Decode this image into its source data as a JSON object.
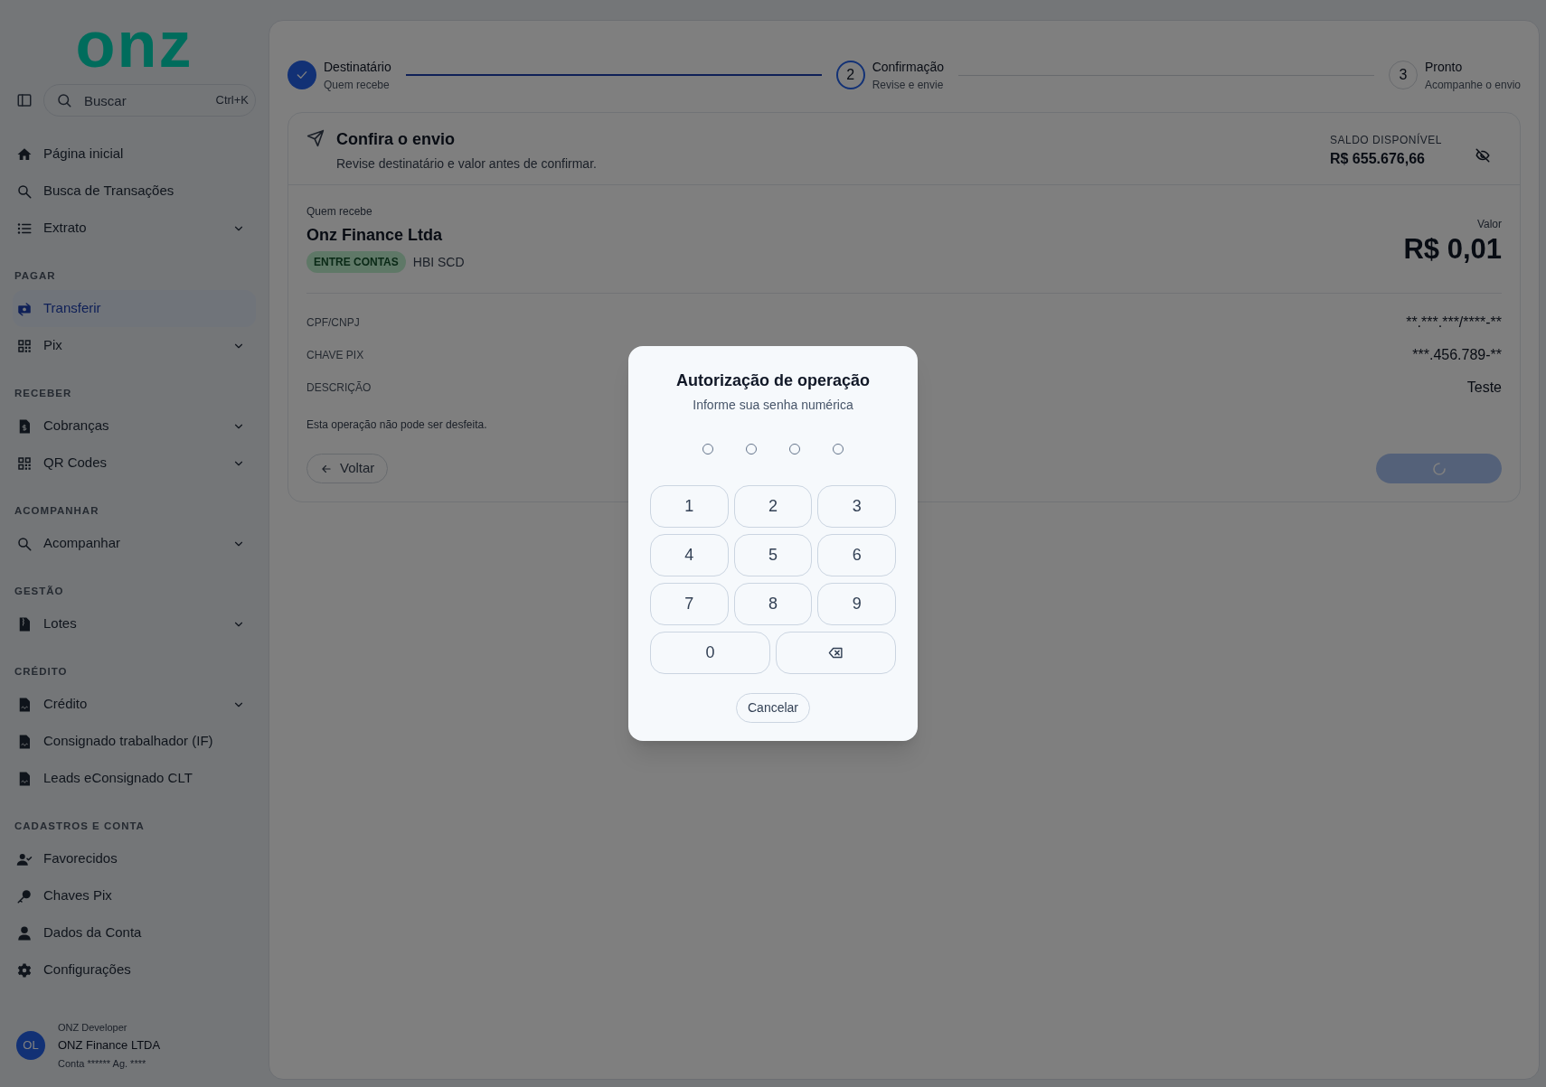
{
  "sidebar": {
    "logo": "onz",
    "search": {
      "placeholder": "Buscar",
      "shortcut": "Ctrl+K"
    },
    "sections": [
      {
        "items": [
          {
            "label": "Página inicial",
            "expandable": false,
            "selected": false
          },
          {
            "label": "Busca de Transações",
            "expandable": false,
            "selected": false
          },
          {
            "label": "Extrato",
            "expandable": true,
            "selected": false
          }
        ]
      },
      {
        "heading": "PAGAR",
        "items": [
          {
            "label": "Transferir",
            "expandable": false,
            "selected": true
          },
          {
            "label": "Pix",
            "expandable": true,
            "selected": false
          }
        ]
      },
      {
        "heading": "RECEBER",
        "items": [
          {
            "label": "Cobranças",
            "expandable": true,
            "selected": false
          },
          {
            "label": "QR Codes",
            "expandable": true,
            "selected": false
          }
        ]
      },
      {
        "heading": "ACOMPANHAR",
        "items": [
          {
            "label": "Acompanhar",
            "expandable": true,
            "selected": false
          }
        ]
      },
      {
        "heading": "GESTÃO",
        "items": [
          {
            "label": "Lotes",
            "expandable": true,
            "selected": false
          }
        ]
      },
      {
        "heading": "CRÉDITO",
        "items": [
          {
            "label": "Crédito",
            "expandable": true,
            "selected": false
          },
          {
            "label": "Consignado trabalhador (IF)",
            "expandable": false,
            "selected": false
          },
          {
            "label": "Leads eConsignado CLT",
            "expandable": false,
            "selected": false
          }
        ]
      },
      {
        "heading": "CADASTROS E CONTA",
        "items": [
          {
            "label": "Favorecidos",
            "expandable": false,
            "selected": false
          },
          {
            "label": "Chaves Pix",
            "expandable": false,
            "selected": false
          },
          {
            "label": "Dados da Conta",
            "expandable": false,
            "selected": false
          },
          {
            "label": "Configurações",
            "expandable": false,
            "selected": false
          }
        ]
      }
    ],
    "user": {
      "initials": "OL",
      "role": "ONZ Developer",
      "company": "ONZ Finance LTDA",
      "account": "Conta ****** Ag. ****"
    }
  },
  "stepper": [
    {
      "title": "Destinatário",
      "subtitle": "Quem recebe",
      "completed": true,
      "selected": false
    },
    {
      "number": "2",
      "title": "Confirmação",
      "subtitle": "Revise e envie",
      "completed": false,
      "selected": true
    },
    {
      "number": "3",
      "title": "Pronto",
      "subtitle": "Acompanhe o envio",
      "completed": false,
      "selected": false
    }
  ],
  "review": {
    "title": "Confira o envio",
    "subtitle": "Revise destinatário e valor antes de confirmar.",
    "balance_label": "SALDO DISPONÍVEL",
    "balance": "R$ 655.676,66",
    "recipient_label": "Quem recebe",
    "recipient": "Onz Finance Ltda",
    "badge": "ENTRE CONTAS",
    "institution": "HBI SCD",
    "amount_label": "Valor",
    "amount": "R$ 0,01",
    "details": [
      {
        "label": "CPF/CNPJ",
        "value": "**.***.***/****-**"
      },
      {
        "label": "CHAVE PIX",
        "value": "***.456.789-**"
      },
      {
        "label": "DESCRIÇÃO",
        "value": "Teste"
      }
    ],
    "note": "Esta operação não pode ser desfeita.",
    "back": "Voltar",
    "confirm_loading": true
  },
  "modal": {
    "title": "Autorização de operação",
    "subtitle": "Informe sua senha numérica",
    "pin": [
      {
        "filled": false
      },
      {
        "filled": false
      },
      {
        "filled": false
      },
      {
        "filled": false
      }
    ],
    "keys": [
      {
        "kind": "digit",
        "label": "1"
      },
      {
        "kind": "digit",
        "label": "2"
      },
      {
        "kind": "digit",
        "label": "3"
      },
      {
        "kind": "digit",
        "label": "4"
      },
      {
        "kind": "digit",
        "label": "5"
      },
      {
        "kind": "digit",
        "label": "6"
      },
      {
        "kind": "digit",
        "label": "7"
      },
      {
        "kind": "digit",
        "label": "8"
      },
      {
        "kind": "digit",
        "label": "9"
      },
      {
        "kind": "wide",
        "label": "0"
      },
      {
        "kind": "backspace"
      }
    ],
    "cancel": "Cancelar"
  }
}
